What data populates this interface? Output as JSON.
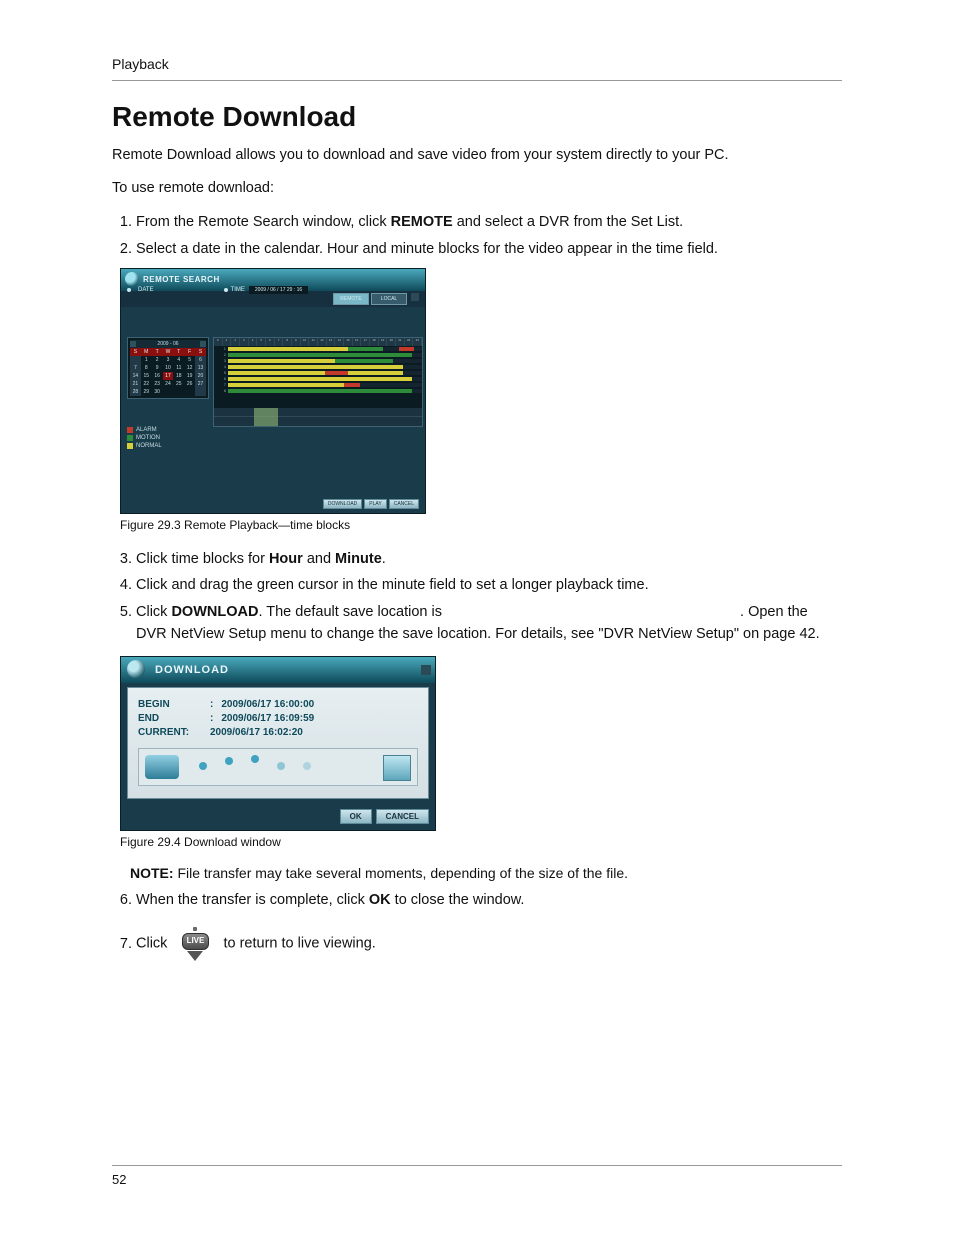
{
  "header": {
    "section": "Playback"
  },
  "title": "Remote Download",
  "intro": "Remote Download allows you to download and save video from your system directly to your PC.",
  "lead": "To use remote download:",
  "steps14": {
    "s1_pre": "From the Remote Search window, click ",
    "s1_kw": "REMOTE",
    "s1_post": " and select a DVR from the Set List.",
    "s2": "Select a date in the calendar. Hour and minute blocks for the video appear in the time field.",
    "s3_pre": "Click time blocks for ",
    "s3_kw1": "Hour",
    "s3_mid": " and ",
    "s3_kw2": "Minute",
    "s3_post": ".",
    "s4": "Click and drag the green cursor in the minute field to set a longer playback time.",
    "s5_pre": "Click ",
    "s5_kw": "DOWNLOAD",
    "s5_mid": ". The default save location is ",
    "s5_post_a": ". Open the DVR NetView Setup menu to change the save location. For details, ",
    "s5_post_b": "see \"DVR NetView Setup\" on page 42.",
    "note_label": "NOTE:",
    "note_text": " File transfer may take several moments, depending of the size of the file.",
    "s6_pre": "When the transfer is complete, click ",
    "s6_kw": "OK",
    "s6_post": " to close the window.",
    "s7_pre": "Click ",
    "s7_post": " to return to live viewing."
  },
  "fig1": {
    "caption": "Figure 29.3 Remote Playback—time blocks",
    "window_title": "REMOTE SEARCH",
    "tabs": {
      "remote": "REMOTE",
      "local": "LOCAL"
    },
    "panel": {
      "date_label": "DATE",
      "time_label": "TIME",
      "time_value": "2009 / 06 / 17  29 : 16"
    },
    "calendar": {
      "title": "2009 - 06",
      "dow": [
        "S",
        "M",
        "T",
        "W",
        "T",
        "F",
        "S"
      ],
      "rows": [
        [
          " ",
          "1",
          "2",
          "3",
          "4",
          "5",
          "6"
        ],
        [
          "7",
          "8",
          "9",
          "10",
          "11",
          "12",
          "13"
        ],
        [
          "14",
          "15",
          "16",
          "17",
          "18",
          "19",
          "20"
        ],
        [
          "21",
          "22",
          "23",
          "24",
          "25",
          "26",
          "27"
        ],
        [
          "28",
          "29",
          "30",
          " ",
          " ",
          " ",
          " "
        ]
      ],
      "selected_day": "17"
    },
    "legend": {
      "alarm": "ALARM",
      "motion": "MOTION",
      "normal": "NORMAL"
    },
    "footer_buttons": {
      "download": "DOWNLOAD",
      "play": "PLAY",
      "cancel": "CANCEL"
    }
  },
  "fig2": {
    "caption": "Figure 29.4 Download window",
    "window_title": "DOWNLOAD",
    "rows": {
      "begin_label": "BEGIN",
      "begin_value": "2009/06/17 16:00:00",
      "end_label": "END",
      "end_value": "2009/06/17 16:09:59",
      "current_label": "CURRENT:",
      "current_value": "2009/06/17 16:02:20"
    },
    "buttons": {
      "ok": "OK",
      "cancel": "CANCEL"
    }
  },
  "live_badge": "LIVE",
  "page_number": "52"
}
